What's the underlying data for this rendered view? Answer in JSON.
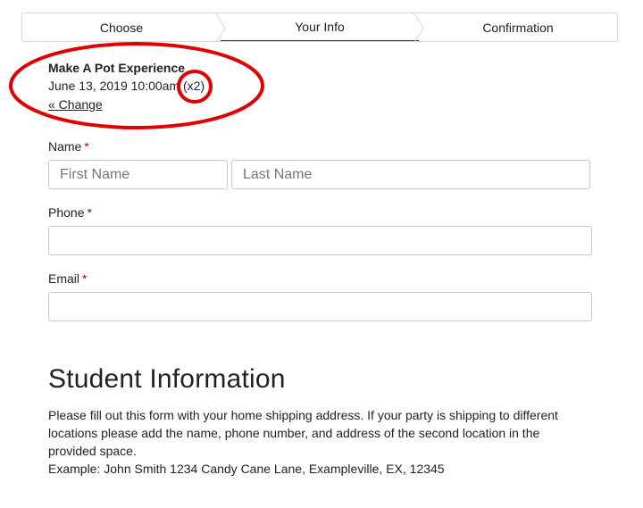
{
  "steps": [
    {
      "label": "Choose",
      "active": false
    },
    {
      "label": "Your Info",
      "active": true
    },
    {
      "label": "Confirmation",
      "active": false
    }
  ],
  "summary": {
    "title": "Make A Pot Experience",
    "date": "June 13, 2019 10:00am",
    "quantity": "(x2)",
    "change_link": "« Change"
  },
  "annotation": {
    "color": "#e00000"
  },
  "form": {
    "name_label": "Name",
    "required_mark": "*",
    "first_name_placeholder": "First Name",
    "last_name_placeholder": "Last Name",
    "phone_label": "Phone",
    "email_label": "Email"
  },
  "student_info": {
    "title": "Student Information",
    "description_lines": [
      "Please fill out this form with your home shipping address. If your party is shipping to different",
      "locations please add the name, phone number, and address of the second location in the",
      "provided space.",
      "Example: John Smith 1234 Candy Cane Lane, Exampleville, EX, 12345"
    ]
  }
}
